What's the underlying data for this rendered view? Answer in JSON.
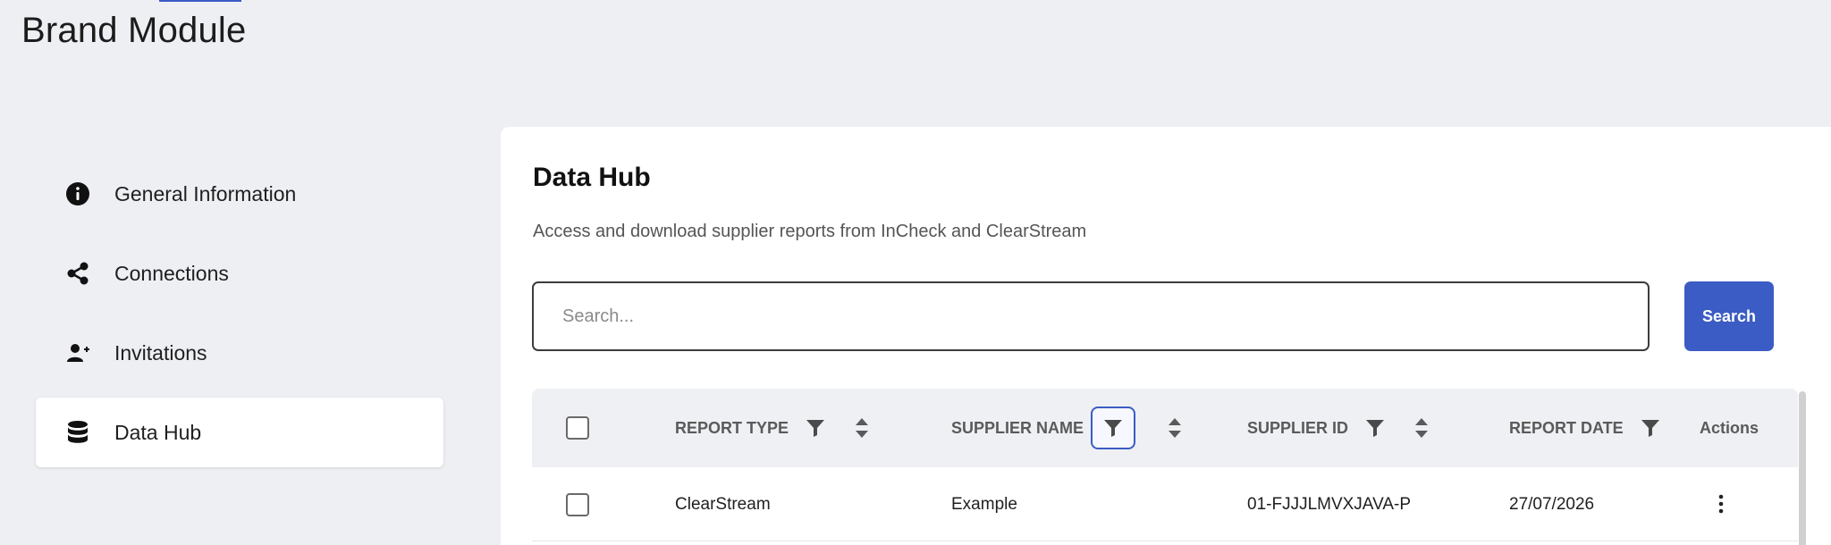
{
  "app": {
    "title": "Brand Module"
  },
  "sidebar": {
    "items": [
      {
        "label": "General Information",
        "icon": "info-icon",
        "active": false
      },
      {
        "label": "Connections",
        "icon": "share-icon",
        "active": false
      },
      {
        "label": "Invitations",
        "icon": "user-plus-icon",
        "active": false
      },
      {
        "label": "Data Hub",
        "icon": "database-icon",
        "active": true
      }
    ]
  },
  "main": {
    "title": "Data Hub",
    "subtitle": "Access and download supplier reports from InCheck and ClearStream",
    "search": {
      "placeholder": "Search...",
      "value": "",
      "button_label": "Search"
    },
    "table": {
      "columns": [
        "REPORT TYPE",
        "SUPPLIER NAME",
        "SUPPLIER ID",
        "REPORT DATE",
        "Actions"
      ],
      "rows": [
        {
          "report_type": "ClearStream",
          "supplier_name": "Example",
          "supplier_id": "01-FJJJLMVXJAVA-P",
          "report_date": "27/07/2026"
        }
      ]
    }
  },
  "colors": {
    "accent": "#3b5cc4",
    "background": "#eeeff3",
    "panel": "#ffffff",
    "header_row": "#eef0f3"
  }
}
